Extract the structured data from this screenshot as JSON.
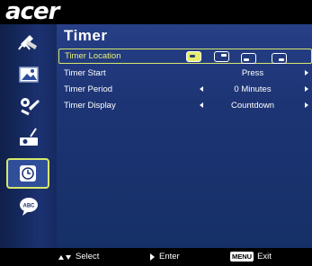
{
  "brand": {
    "logo_text": "acer"
  },
  "sidebar": {
    "items": [
      {
        "icon": "color-wheel-icon",
        "selected": false
      },
      {
        "icon": "image-icon",
        "selected": false
      },
      {
        "icon": "settings-icon",
        "selected": false
      },
      {
        "icon": "projector-icon",
        "selected": false
      },
      {
        "icon": "clock-icon",
        "selected": true
      },
      {
        "icon": "language-icon",
        "label": "ABC",
        "selected": false
      }
    ]
  },
  "main": {
    "title": "Timer",
    "rows": [
      {
        "label": "Timer Location",
        "selected": true,
        "options": [
          "top-left-icon",
          "top-right-icon",
          "bottom-left-icon",
          "bottom-right-icon"
        ],
        "selected_option": 0
      },
      {
        "label": "Timer Start",
        "value": "Press",
        "has_left_arrow": false,
        "has_right_arrow": true
      },
      {
        "label": "Timer Period",
        "value": "0  Minutes",
        "has_left_arrow": true,
        "has_right_arrow": true
      },
      {
        "label": "Timer Display",
        "value": "Countdown",
        "has_left_arrow": true,
        "has_right_arrow": true
      }
    ]
  },
  "footer": {
    "select_label": "Select",
    "enter_label": "Enter",
    "menu_key": "MENU",
    "exit_label": "Exit"
  },
  "colors": {
    "highlight": "#d6e86a",
    "panel": "#1d3474",
    "sidebar": "#1b3170"
  }
}
